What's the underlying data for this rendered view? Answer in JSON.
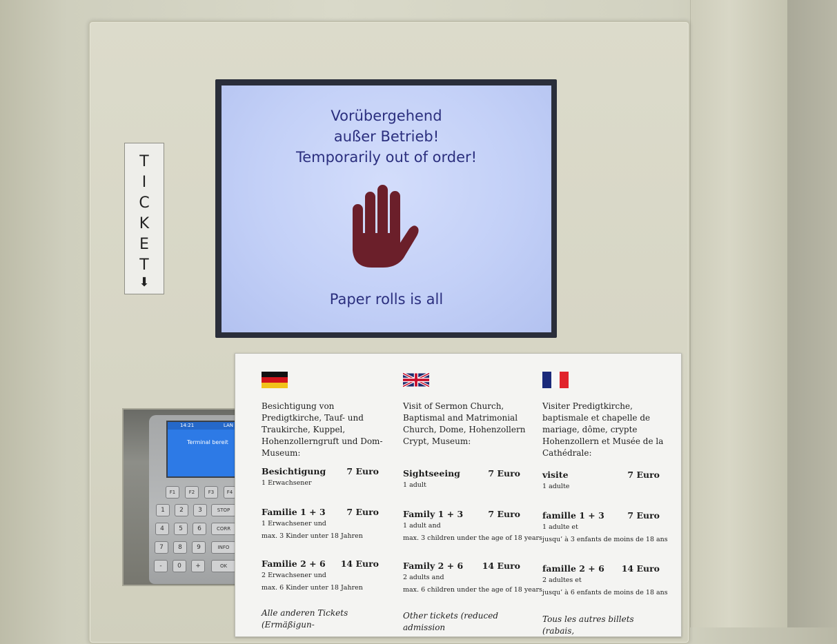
{
  "ticket_slot": {
    "letters": [
      "T",
      "I",
      "C",
      "K",
      "E",
      "T"
    ],
    "arrow": "⬇"
  },
  "screen": {
    "line1": "Vorübergehend",
    "line2": "außer Betrieb!",
    "line3": "Temporarily out of order!",
    "footer": "Paper rolls is all",
    "icon": "stop-hand-icon",
    "hand_color": "#6b1f2a",
    "text_color": "#2b2f7e"
  },
  "terminal": {
    "time": "14:21",
    "network": "LAN",
    "status": "Terminal bereit",
    "function_keys": [
      "F1",
      "F2",
      "F3",
      "F4"
    ],
    "number_keys": [
      "1",
      "2",
      "3",
      "4",
      "5",
      "6",
      "7",
      "8",
      "9",
      "-",
      "0",
      "+"
    ],
    "side_keys": [
      "STOP",
      "CORR",
      "INFO",
      "OK"
    ]
  },
  "price_sign": {
    "columns": [
      {
        "flag": "germany-flag-icon",
        "intro": "Besichtigung von Predigtkirche, Tauf- und Traukirche, Kuppel, Hohenzollerngruft und Dom-Museum:",
        "items": [
          {
            "name": "Besichtigung",
            "price": "7 Euro",
            "details": [
              "1 Erwachsener"
            ]
          },
          {
            "name": "Familie 1 + 3",
            "price": "7 Euro",
            "details": [
              "1 Erwachsener und",
              "max. 3 Kinder unter 18 Jahren"
            ]
          },
          {
            "name": "Familie 2 + 6",
            "price": "14 Euro",
            "details": [
              "2 Erwachsener und",
              "max. 6 Kinder unter 18 Jahren"
            ]
          }
        ],
        "other": "Alle anderen Tickets (Ermäßigun-"
      },
      {
        "flag": "uk-flag-icon",
        "intro": "Visit of Sermon Church, Baptismal and Matrimonial Church, Dome, Hohenzollern Crypt, Museum:",
        "items": [
          {
            "name": "Sightseeing",
            "price": "7 Euro",
            "details": [
              "1 adult"
            ]
          },
          {
            "name": "Family 1 + 3",
            "price": "7 Euro",
            "details": [
              "1 adult and",
              "max. 3 children under the age of 18 years"
            ]
          },
          {
            "name": "Family 2 + 6",
            "price": "14 Euro",
            "details": [
              "2 adults and",
              "max. 6 children under the age of 18 years"
            ]
          }
        ],
        "other": "Other tickets (reduced admission"
      },
      {
        "flag": "france-flag-icon",
        "intro": "Visiter Predigtkirche, baptismale et chapelle de mariage, dôme, crypte Hohenzollern et Musée de la Cathédrale:",
        "items": [
          {
            "name": "visite",
            "price": "7 Euro",
            "details": [
              "1 adulte"
            ]
          },
          {
            "name": "famille 1 + 3",
            "price": "7 Euro",
            "details": [
              "1 adulte et",
              "jusqu’ à 3 enfants de moins de 18 ans"
            ]
          },
          {
            "name": "famille 2 + 6",
            "price": "14 Euro",
            "details": [
              "2 adultes et",
              "jusqu’ à 6 enfants de moins de 18 ans"
            ]
          }
        ],
        "other": "Tous les autres billets (rabais,"
      }
    ]
  }
}
